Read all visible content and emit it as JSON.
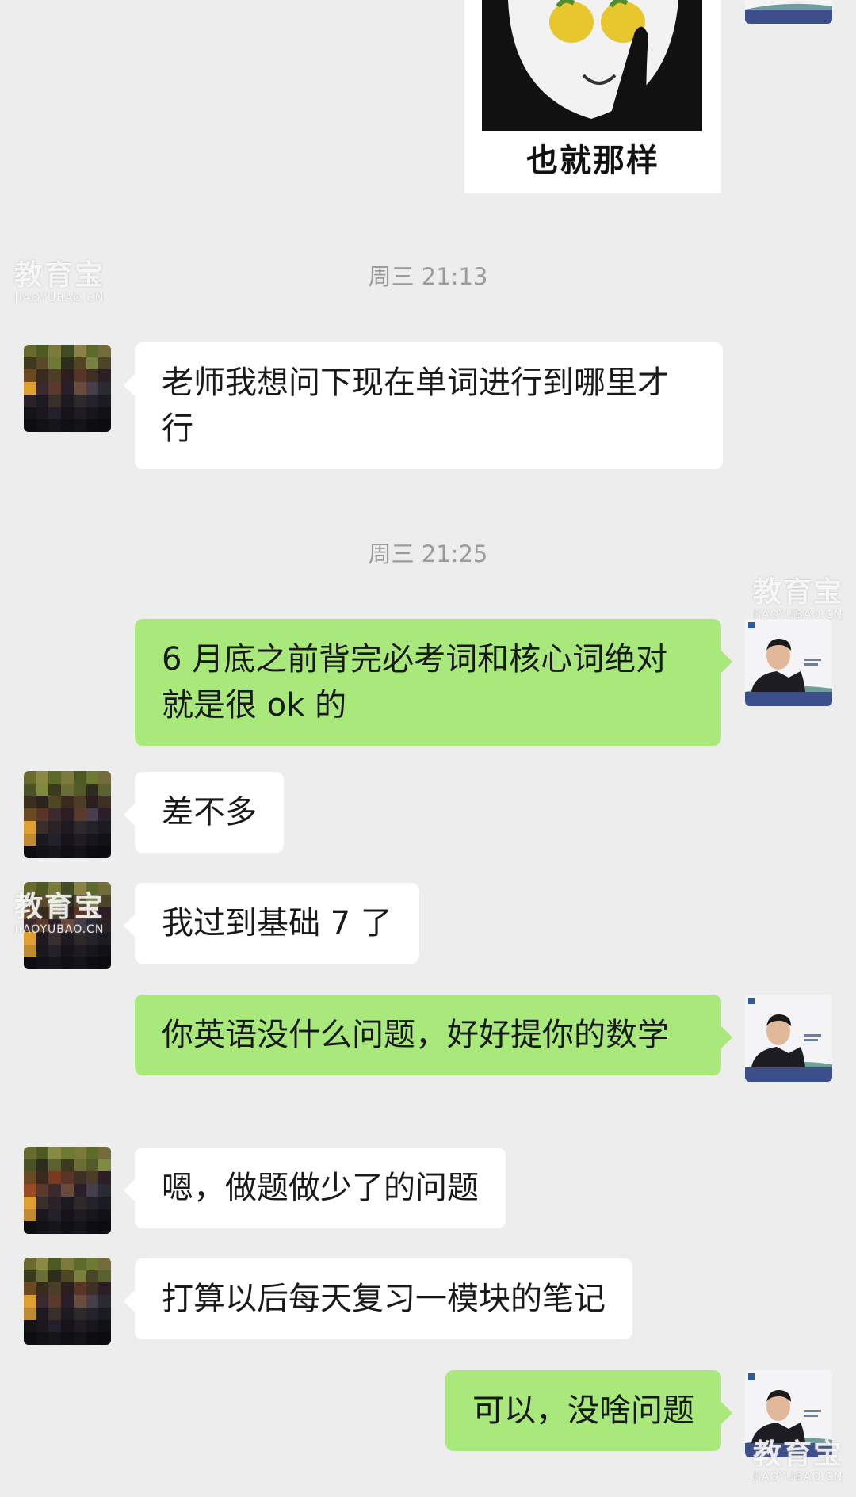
{
  "sticker": {
    "caption": "也就那样"
  },
  "timestamps": [
    "周三 21:13",
    "周三 21:25"
  ],
  "messages": [
    {
      "from": "contact",
      "text": "老师我想问下现在单词进行到哪里才行"
    },
    {
      "from": "me",
      "text": "6 月底之前背完必考词和核心词绝对就是很 ok 的"
    },
    {
      "from": "contact",
      "text": "差不多"
    },
    {
      "from": "contact",
      "text": "我过到基础 7 了"
    },
    {
      "from": "me",
      "text": "你英语没什么问题，好好提你的数学"
    },
    {
      "from": "contact",
      "text": "嗯，做题做少了的问题"
    },
    {
      "from": "contact",
      "text": "打算以后每天复习一模块的笔记"
    },
    {
      "from": "me",
      "text": "可以，没啥问题"
    }
  ],
  "watermark": {
    "cn": "教育宝",
    "en": "JIAOYUBAO.CN"
  },
  "colors": {
    "background": "#ededed",
    "incoming_bubble": "#ffffff",
    "outgoing_bubble": "#a9e97c",
    "timestamp": "#9b9b9b"
  },
  "icons": {
    "contact_avatar": "pixelated-avatar",
    "own_avatar": "person-photo-avatar",
    "sticker": "panda-meme-sticker"
  }
}
